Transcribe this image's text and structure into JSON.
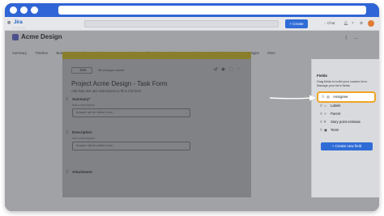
{
  "app": {
    "name": "Jira"
  },
  "topnav": {
    "create_label": "+ Create",
    "chat_label": "Chat"
  },
  "breadcrumb": "Projects",
  "project": {
    "title": "Acme Design"
  },
  "tabs": [
    {
      "label": "Summary",
      "active": false
    },
    {
      "label": "Timeline",
      "active": false
    },
    {
      "label": "Board",
      "active": false
    },
    {
      "label": "Calendar",
      "active": false
    },
    {
      "label": "List",
      "active": false
    },
    {
      "label": "Forms",
      "active": true
    },
    {
      "label": "Goals",
      "active": false
    },
    {
      "label": "All work",
      "active": false
    },
    {
      "label": "Development",
      "active": false
    },
    {
      "label": "Code",
      "active": false
    },
    {
      "label": "Archived work items",
      "active": false
    },
    {
      "label": "Pages",
      "active": false
    },
    {
      "label": "More",
      "active": false
    }
  ],
  "form": {
    "type_select": "Task",
    "changes_saved": "All changes saved",
    "title": "Project Acme Design - Task Form",
    "description": "Add help text and instructions to fill in this form",
    "fields": [
      {
        "label": "Summary*",
        "sub": "Add a description",
        "placeholder": "Answer will be written here"
      },
      {
        "label": "Description",
        "sub": "Add a description",
        "placeholder": "Answer will be written here"
      },
      {
        "label": "Attachment",
        "sub": "",
        "placeholder": ""
      }
    ]
  },
  "fields_panel": {
    "title": "Fields",
    "description": "Drag fields to build your custom form. Manage your form fields",
    "highlighted_item": "Assignee",
    "items": [
      {
        "label": "Labels",
        "icon": "tag-icon"
      },
      {
        "label": "Parent",
        "icon": "link-icon"
      },
      {
        "label": "Story point estimate",
        "icon": "hash-icon"
      },
      {
        "label": "Team",
        "icon": "team-icon"
      }
    ],
    "create_button": "+ Create new field"
  },
  "colors": {
    "accent": "#2f6cd6",
    "highlight": "#f0a524",
    "browser_bar": "#2f65d6"
  }
}
